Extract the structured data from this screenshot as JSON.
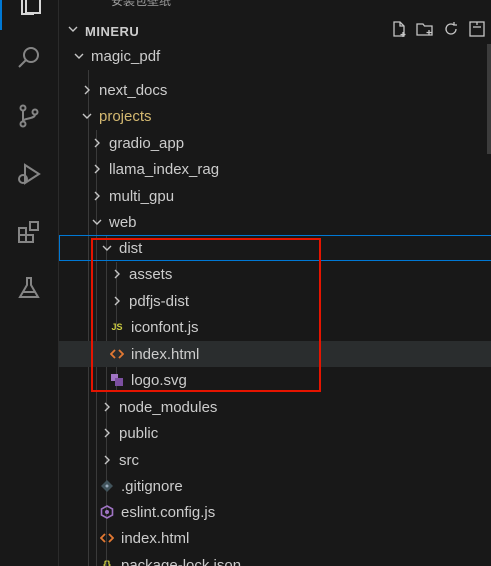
{
  "window": {
    "partial_title": "安装包壁纸"
  },
  "activity_bar": {
    "items": [
      {
        "name": "explorer",
        "icon": "files-icon",
        "active": true
      },
      {
        "name": "search",
        "icon": "search-icon"
      },
      {
        "name": "source-control",
        "icon": "source-control-icon"
      },
      {
        "name": "run-debug",
        "icon": "run-debug-icon"
      },
      {
        "name": "extensions",
        "icon": "extensions-icon"
      },
      {
        "name": "testing",
        "icon": "flask-icon"
      }
    ]
  },
  "explorer": {
    "section_title": "MINERU",
    "toolbar": {
      "new_file_icon": "new-file-icon",
      "new_folder_icon": "new-folder-icon",
      "refresh_icon": "refresh-icon",
      "collapse_icon": "collapse-all-icon"
    },
    "tree": [
      {
        "label": "magic_pdf",
        "type": "folder",
        "expanded": true
      },
      {
        "label": "next_docs",
        "type": "folder",
        "expanded": false
      },
      {
        "label": "projects",
        "type": "folder",
        "expanded": true,
        "modified": true
      },
      {
        "label": "gradio_app",
        "type": "folder",
        "expanded": false
      },
      {
        "label": "llama_index_rag",
        "type": "folder",
        "expanded": false
      },
      {
        "label": "multi_gpu",
        "type": "folder",
        "expanded": false
      },
      {
        "label": "web",
        "type": "folder",
        "expanded": true
      },
      {
        "label": "dist",
        "type": "folder",
        "expanded": true
      },
      {
        "label": "assets",
        "type": "folder",
        "expanded": false
      },
      {
        "label": "pdfjs-dist",
        "type": "folder",
        "expanded": false
      },
      {
        "label": "iconfont.js",
        "type": "file",
        "icon": "js-file-icon",
        "badge": "JS"
      },
      {
        "label": "index.html",
        "type": "file",
        "icon": "html-file-icon"
      },
      {
        "label": "logo.svg",
        "type": "file",
        "icon": "svg-file-icon"
      },
      {
        "label": "node_modules",
        "type": "folder",
        "expanded": false
      },
      {
        "label": "public",
        "type": "folder",
        "expanded": false
      },
      {
        "label": "src",
        "type": "folder",
        "expanded": false
      },
      {
        "label": ".gitignore",
        "type": "file",
        "icon": "git-file-icon"
      },
      {
        "label": "eslint.config.js",
        "type": "file",
        "icon": "eslint-file-icon"
      },
      {
        "label": "index.html",
        "type": "file",
        "icon": "html-file-icon"
      },
      {
        "label": "package-lock.json",
        "type": "file",
        "icon": "json-file-icon",
        "badge": "{}"
      }
    ]
  },
  "colors": {
    "accent": "#0078d4",
    "highlight_box": "#e51400",
    "js_icon": "#cbcb41",
    "html_icon": "#e37933",
    "svg_icon": "#a074c4",
    "json_icon": "#cbcb41"
  }
}
